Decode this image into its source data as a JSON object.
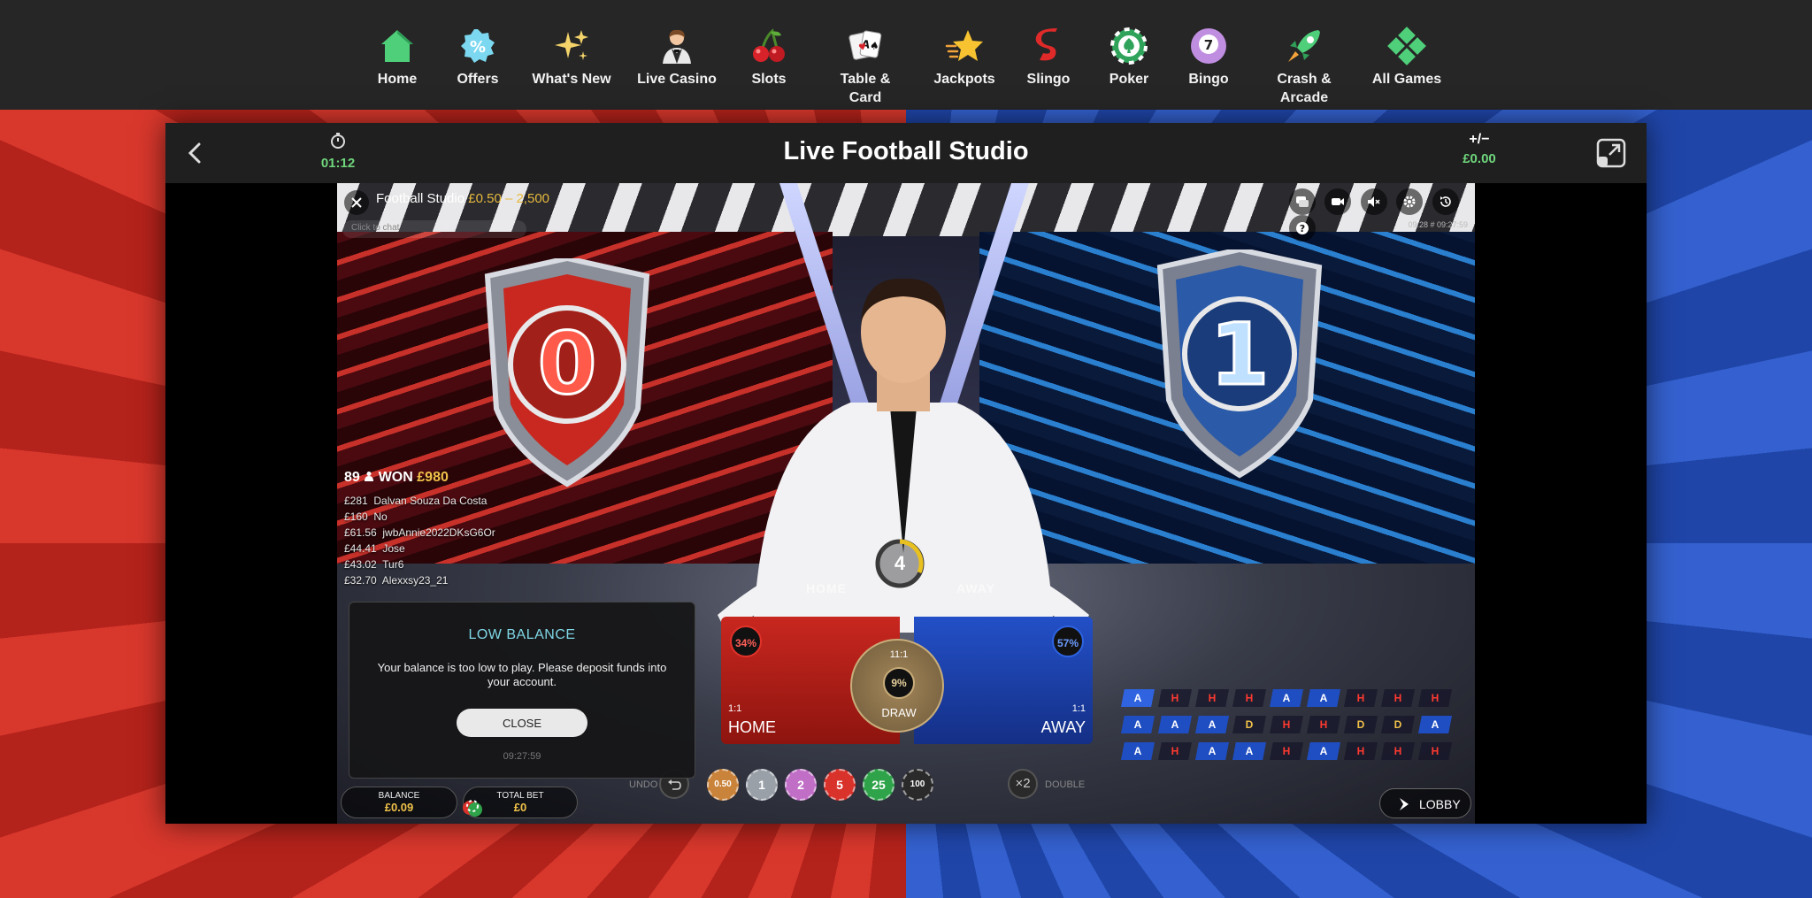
{
  "nav": [
    {
      "label": "Home",
      "icon": "home-icon"
    },
    {
      "label": "Offers",
      "icon": "offers-icon"
    },
    {
      "label": "What's New",
      "icon": "sparkle-icon"
    },
    {
      "label": "Live Casino",
      "icon": "dealer-icon"
    },
    {
      "label": "Slots",
      "icon": "cherries-icon"
    },
    {
      "label": "Table &",
      "label2": "Card",
      "icon": "cards-icon"
    },
    {
      "label": "Jackpots",
      "icon": "star-icon"
    },
    {
      "label": "Slingo",
      "icon": "slingo-icon"
    },
    {
      "label": "Poker",
      "icon": "poker-chip-icon"
    },
    {
      "label": "Bingo",
      "icon": "bingo-ball-icon",
      "ball": "7"
    },
    {
      "label": "Crash &",
      "label2": "Arcade",
      "icon": "rocket-icon"
    },
    {
      "label": "All Games",
      "icon": "grid-icon"
    }
  ],
  "header": {
    "timer": "01:12",
    "title": "Live Football Studio",
    "pl_label": "+/−",
    "pl_value": "£0.00"
  },
  "video": {
    "game_name": "Football Studio",
    "limits": "£0.50 – 2,500",
    "chat_placeholder": "Click to chat",
    "clock": "09:28  # 09:27:59",
    "shield_home": "0",
    "shield_away": "1",
    "countdown": "4",
    "table_home": "HOME",
    "table_away": "AWAY"
  },
  "winners": {
    "count": "89",
    "won_label": "WON",
    "won_amount": "£980",
    "list": [
      {
        "amount": "£281",
        "name": "Dalvan Souza Da Costa"
      },
      {
        "amount": "£160",
        "name": "No"
      },
      {
        "amount": "£61.56",
        "name": "jwbAnnie2022DKsG6Or"
      },
      {
        "amount": "£44.41",
        "name": "Jose"
      },
      {
        "amount": "£43.02",
        "name": "Tur6"
      },
      {
        "amount": "£32.70",
        "name": "Alexxsy23_21"
      }
    ]
  },
  "bets": {
    "home": {
      "label": "HOME",
      "pct": "34%",
      "odds": "1:1"
    },
    "away": {
      "label": "AWAY",
      "pct": "57%",
      "odds": "1:1"
    },
    "draw": {
      "label": "DRAW",
      "pct": "9%",
      "odds": "11:1"
    }
  },
  "roadmap": [
    [
      "A",
      "H",
      "H",
      "H",
      "A",
      "A",
      "H",
      "H",
      "H"
    ],
    [
      "A",
      "A",
      "A",
      "D",
      "H",
      "H",
      "D",
      "D",
      "A"
    ],
    [
      "A",
      "H",
      "A",
      "A",
      "H",
      "A",
      "H",
      "H",
      "H"
    ]
  ],
  "chips": {
    "undo": "UNDO",
    "double": "DOUBLE",
    "x2": "×2",
    "values": [
      {
        "v": "0.50",
        "color": "#c9833a",
        "fg": "#fff"
      },
      {
        "v": "1",
        "color": "#9aa0a8",
        "fg": "#fff"
      },
      {
        "v": "2",
        "color": "#c06ec6",
        "fg": "#fff"
      },
      {
        "v": "5",
        "color": "#d8322a",
        "fg": "#fff"
      },
      {
        "v": "25",
        "color": "#2fa34a",
        "fg": "#fff"
      },
      {
        "v": "100",
        "color": "#2a2a2a",
        "fg": "#fff"
      }
    ]
  },
  "balance": {
    "label": "BALANCE",
    "value": "£0.09"
  },
  "total_bet": {
    "label": "TOTAL BET",
    "value": "£0"
  },
  "lobby": {
    "label": "LOBBY"
  },
  "modal": {
    "title": "LOW BALANCE",
    "message": "Your balance is too low to play. Please deposit funds into your account.",
    "button": "CLOSE",
    "time": "09:27:59"
  },
  "colors": {
    "accent_green": "#6fd67c",
    "gold": "#f0c24a",
    "home_red": "#c8271f",
    "away_blue": "#2350c7"
  }
}
